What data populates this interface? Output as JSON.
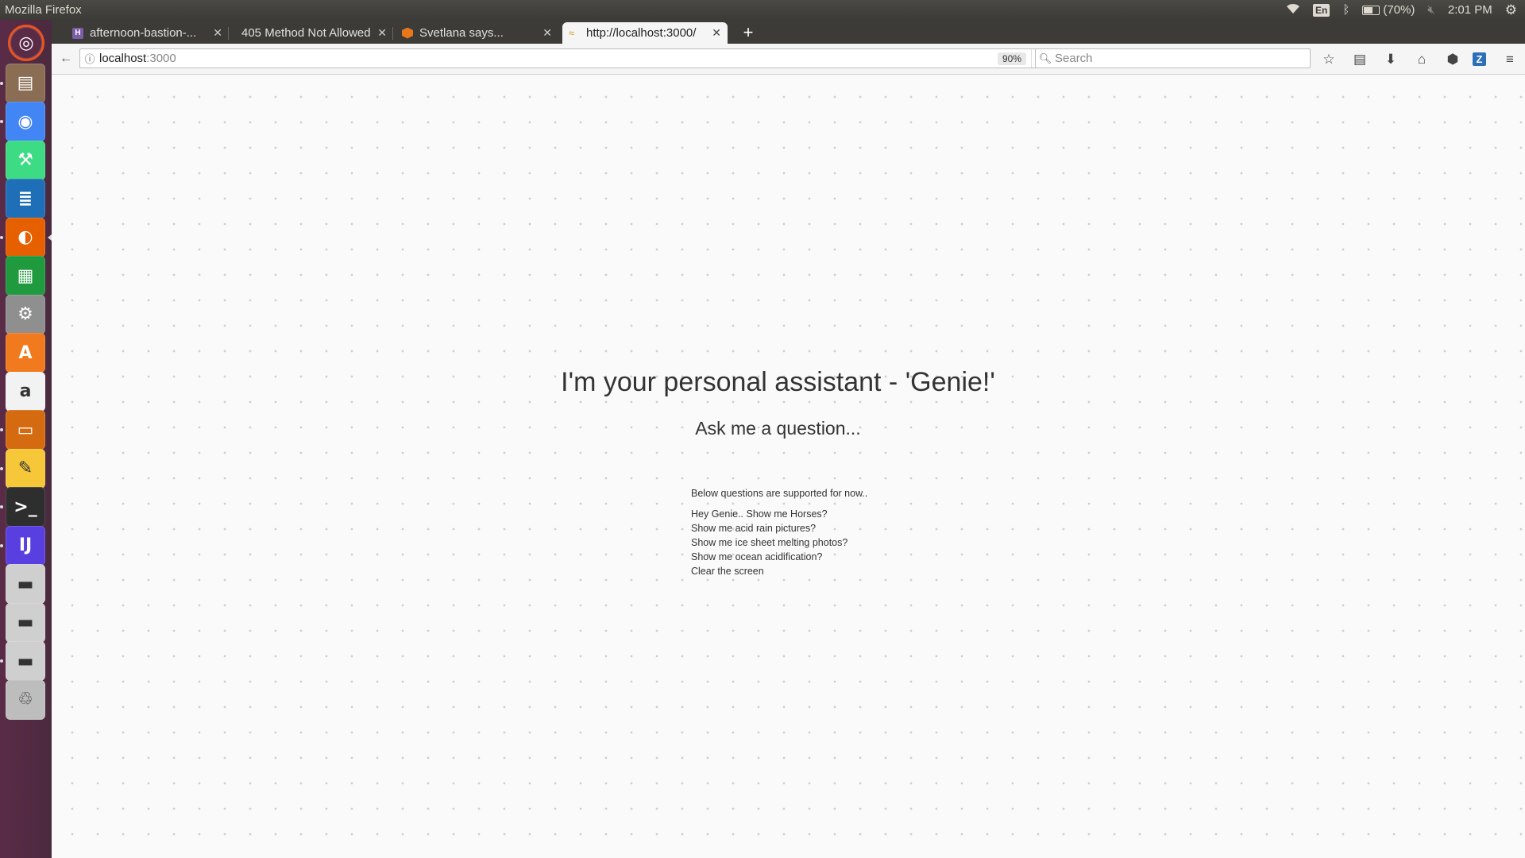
{
  "system_bar": {
    "app_title": "Mozilla Firefox",
    "keyboard_layout": "En",
    "battery": "(70%)",
    "battery_level": 0.7,
    "clock": "2:01 PM"
  },
  "launcher": {
    "items": [
      {
        "name": "ubuntu-dash-icon",
        "color": "#e95420"
      },
      {
        "name": "files-icon",
        "color": "#8a6d52"
      },
      {
        "name": "chrome-icon",
        "color": "#4285f4"
      },
      {
        "name": "android-studio-icon",
        "color": "#3ddc84"
      },
      {
        "name": "writer-icon",
        "color": "#1e6fb8"
      },
      {
        "name": "firefox-icon",
        "color": "#e66000"
      },
      {
        "name": "calc-icon",
        "color": "#1f9a3e"
      },
      {
        "name": "system-settings-icon",
        "color": "#8f8f8f"
      },
      {
        "name": "software-center-icon",
        "color": "#f07a1d"
      },
      {
        "name": "amazon-icon",
        "color": "#f2f2f2"
      },
      {
        "name": "impress-icon",
        "color": "#d56b10"
      },
      {
        "name": "text-editor-icon",
        "color": "#f7c73a"
      },
      {
        "name": "terminal-icon",
        "color": "#2e2e2e"
      },
      {
        "name": "intellij-icon",
        "color": "#5a3fe0"
      },
      {
        "name": "drive-icon-1",
        "color": "#cfcfcf"
      },
      {
        "name": "drive-icon-2",
        "color": "#cfcfcf"
      },
      {
        "name": "drive-icon-3",
        "color": "#cfcfcf"
      },
      {
        "name": "trash-icon",
        "color": "#bdbdbd"
      }
    ]
  },
  "browser": {
    "tabs": [
      {
        "label": "afternoon-bastion-...",
        "favicon_color": "#7b5ea7",
        "favicon_letter": "H"
      },
      {
        "label": "405 Method Not Allowed",
        "favicon_color": "",
        "favicon_letter": ""
      },
      {
        "label": "Svetlana says...",
        "favicon_color": "#e8761b",
        "favicon_letter": ""
      },
      {
        "label": "http://localhost:3000/",
        "favicon_color": "#f0b030",
        "favicon_letter": ""
      }
    ],
    "new_tab": "+",
    "url_host": "localhost",
    "url_port": ":3000",
    "zoom": "90%",
    "search_placeholder": "Search"
  },
  "page": {
    "headline": "I'm your personal assistant - 'Genie!'",
    "subline": "Ask me a question...",
    "intro": "Below questions are supported for now..",
    "questions": [
      "Hey Genie.. Show me Horses?",
      "Show me acid rain pictures?",
      "Show me ice sheet melting photos?",
      "Show me ocean acidification?",
      "Clear the screen"
    ]
  }
}
